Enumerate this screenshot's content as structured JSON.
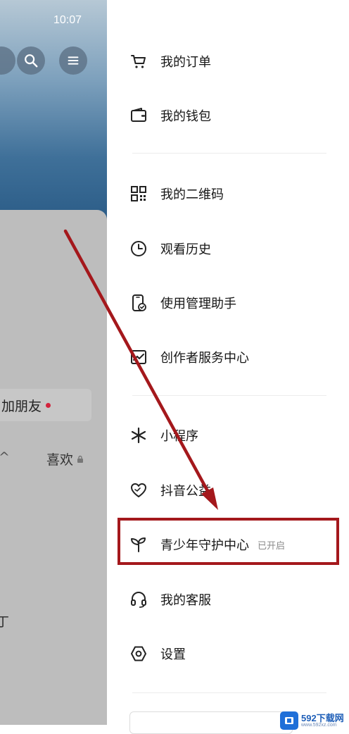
{
  "status_bar": {
    "time": "10:07"
  },
  "background_profile": {
    "add_friend_label": "加朋友",
    "likes_tab_label": "喜欢",
    "partial_left_char": "友",
    "partial_bottom_char": "丁"
  },
  "drawer": {
    "items": [
      {
        "id": "orders",
        "label": "我的订单",
        "icon": "cart-icon"
      },
      {
        "id": "wallet",
        "label": "我的钱包",
        "icon": "wallet-icon"
      },
      {
        "id": "qrcode",
        "label": "我的二维码",
        "icon": "qrcode-icon"
      },
      {
        "id": "history",
        "label": "观看历史",
        "icon": "clock-icon"
      },
      {
        "id": "usage-manager",
        "label": "使用管理助手",
        "icon": "phone-check-icon"
      },
      {
        "id": "creator-center",
        "label": "创作者服务中心",
        "icon": "chart-icon"
      },
      {
        "id": "mini-programs",
        "label": "小程序",
        "icon": "asterisk-icon"
      },
      {
        "id": "charity",
        "label": "抖音公益",
        "icon": "heart-icon"
      },
      {
        "id": "youth-mode",
        "label": "青少年守护中心",
        "icon": "sprout-icon",
        "badge": "已开启"
      },
      {
        "id": "customer-service",
        "label": "我的客服",
        "icon": "headset-icon"
      },
      {
        "id": "settings",
        "label": "设置",
        "icon": "hexagon-settings-icon"
      }
    ]
  },
  "annotation": {
    "highlight_color": "#a4181c",
    "arrow_color": "#a4181c"
  },
  "watermark": {
    "main": "592下载网",
    "sub": "www.592xz.com"
  }
}
